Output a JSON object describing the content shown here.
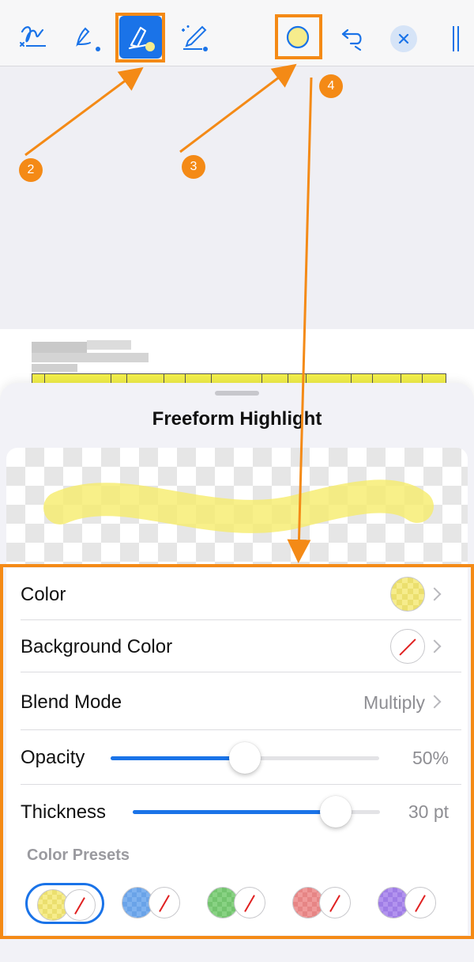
{
  "toolbar": {
    "tools": [
      {
        "name": "signature-tool",
        "icon": "signature-icon"
      },
      {
        "name": "ink-tool",
        "icon": "pen-icon"
      },
      {
        "name": "freeform-highlight-tool",
        "icon": "highlighter-icon",
        "selected": true
      },
      {
        "name": "magic-ink-tool",
        "icon": "magic-pen-icon"
      },
      {
        "name": "color-picker",
        "icon": "color-circle-icon",
        "color": "#f6ec8c"
      },
      {
        "name": "undo",
        "icon": "undo-icon"
      },
      {
        "name": "close",
        "icon": "close-icon"
      },
      {
        "name": "menu",
        "icon": "handle-icon"
      }
    ],
    "accent": "#1a73e8"
  },
  "sheet": {
    "title": "Freeform Highlight"
  },
  "settings": {
    "color": {
      "label": "Color",
      "value": "#f6ec8c"
    },
    "background_color": {
      "label": "Background Color",
      "value": "none"
    },
    "blend_mode": {
      "label": "Blend Mode",
      "value": "Multiply"
    },
    "opacity": {
      "label": "Opacity",
      "value": "50%",
      "fraction": 0.5
    },
    "thickness": {
      "label": "Thickness",
      "value": "30 pt",
      "fraction": 0.82
    }
  },
  "presets": {
    "label": "Color Presets",
    "items": [
      {
        "color": "yellow",
        "selected": true
      },
      {
        "color": "blue",
        "selected": false
      },
      {
        "color": "green",
        "selected": false
      },
      {
        "color": "red",
        "selected": false
      },
      {
        "color": "purple",
        "selected": false
      }
    ]
  },
  "annotations": {
    "badges": [
      "2",
      "3",
      "4"
    ],
    "color": "#f48a16"
  }
}
